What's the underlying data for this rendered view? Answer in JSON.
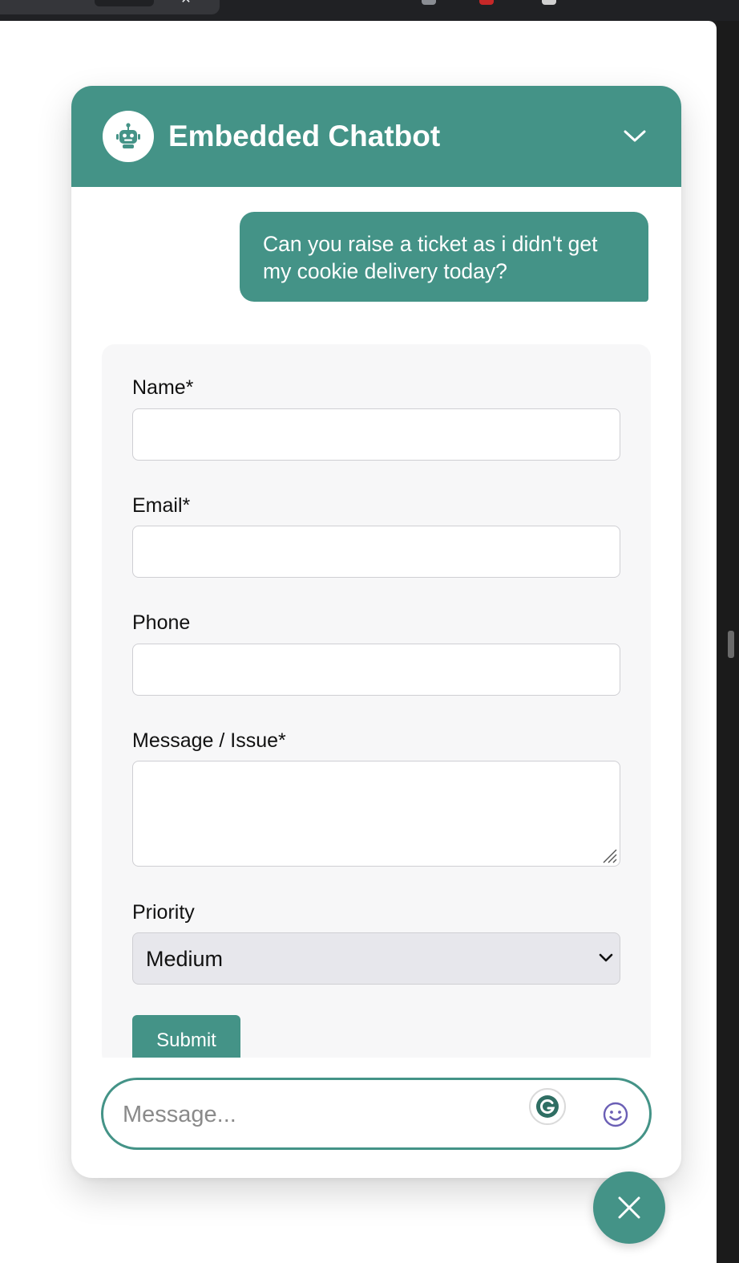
{
  "colors": {
    "accent": "#449387",
    "header_text": "#ffffff",
    "form_card_bg": "#f7f7f8",
    "select_bg": "#e7e7ec"
  },
  "browser": {
    "tab_close_glyph": "✕"
  },
  "chat": {
    "title": "Embedded Chatbot",
    "avatar_icon": "robot-icon",
    "collapse_icon": "chevron-down-icon",
    "messages": [
      {
        "sender": "user",
        "text": "Can you raise a ticket as i didn't get my cookie delivery today?"
      }
    ]
  },
  "ticket_form": {
    "name_label": "Name*",
    "name_value": "",
    "email_label": "Email*",
    "email_value": "",
    "phone_label": "Phone",
    "phone_value": "",
    "message_label": "Message / Issue*",
    "message_value": "",
    "priority_label": "Priority",
    "priority_value": "Medium",
    "submit_label": "Submit"
  },
  "composer": {
    "placeholder": "Message...",
    "grammarly_icon": "grammarly-icon",
    "emoji_icon": "smiley-icon"
  },
  "launcher": {
    "icon": "close-icon"
  }
}
